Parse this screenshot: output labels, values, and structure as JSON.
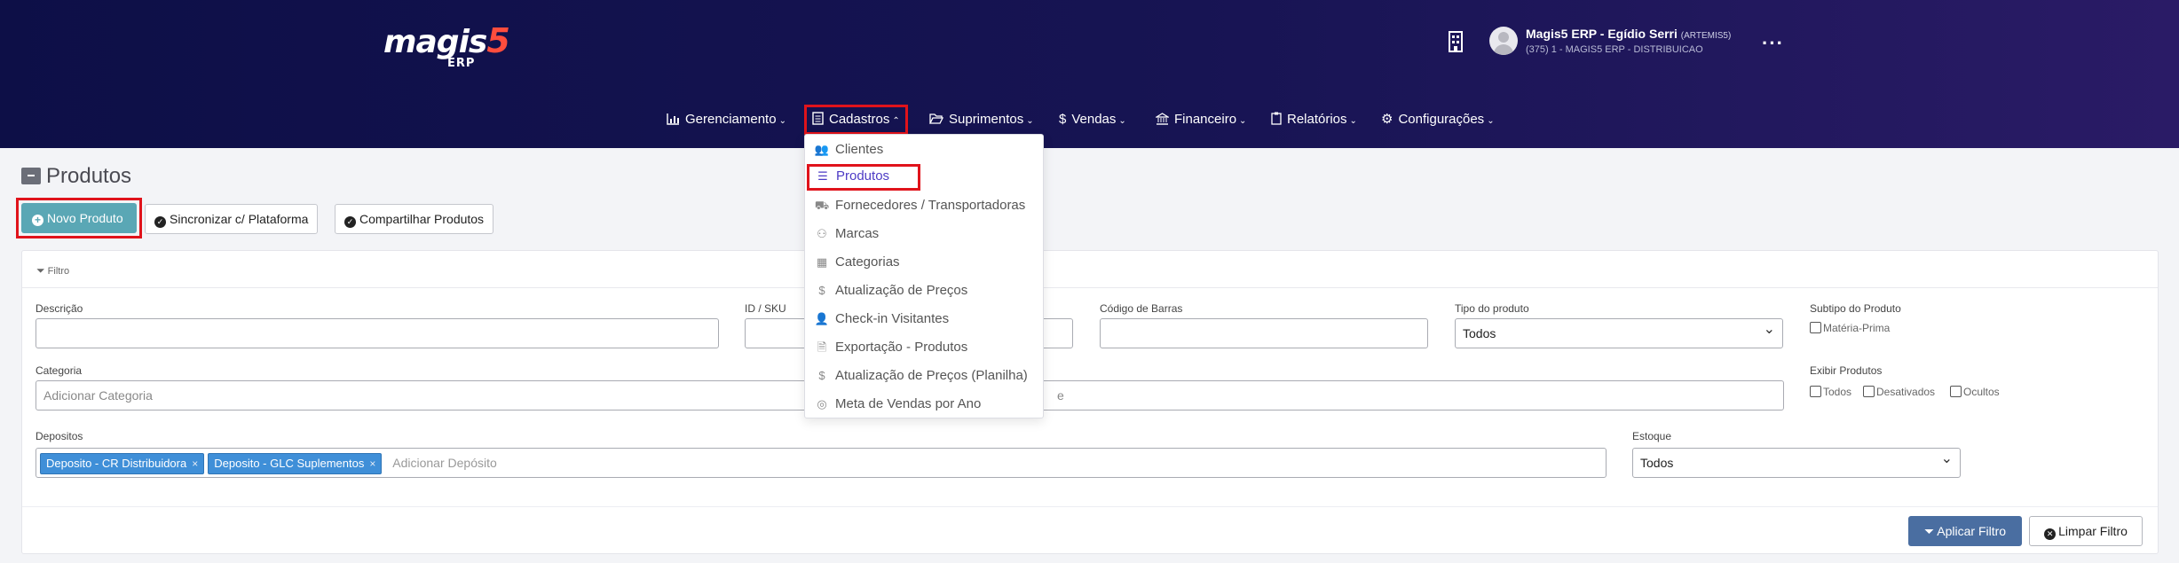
{
  "header": {
    "logo_text": "magis",
    "logo_five": "5",
    "logo_sub": "ERP",
    "user_name": "Magis5 ERP - Egídio Serri",
    "user_tag": "(ARTEMIS5)",
    "user_company": "(375) 1 - MAGIS5 ERP - DISTRIBUICAO",
    "more": "···"
  },
  "nav": {
    "items": [
      {
        "label": "Gerenciamento",
        "icon": "chart-icon"
      },
      {
        "label": "Cadastros",
        "icon": "document-icon"
      },
      {
        "label": "Suprimentos",
        "icon": "folder-open-icon"
      },
      {
        "label": "Vendas",
        "icon": "dollar-icon"
      },
      {
        "label": "Financeiro",
        "icon": "bank-icon"
      },
      {
        "label": "Relatórios",
        "icon": "clipboard-icon"
      },
      {
        "label": "Configurações",
        "icon": "gear-icon"
      }
    ]
  },
  "dropdown": {
    "items": [
      {
        "label": "Clientes",
        "icon": "users-icon"
      },
      {
        "label": "Produtos",
        "icon": "list-icon"
      },
      {
        "label": "Fornecedores / Transportadoras",
        "icon": "truck-icon"
      },
      {
        "label": "Marcas",
        "icon": "sitemap-icon"
      },
      {
        "label": "Categorias",
        "icon": "grid-icon"
      },
      {
        "label": "Atualização de Preços",
        "icon": "dollar-icon"
      },
      {
        "label": "Check-in Visitantes",
        "icon": "user-check-icon"
      },
      {
        "label": "Exportação - Produtos",
        "icon": "file-export-icon"
      },
      {
        "label": "Atualização de Preços (Planilha)",
        "icon": "dollar-icon"
      },
      {
        "label": "Meta de Vendas por Ano",
        "icon": "target-icon"
      }
    ]
  },
  "page": {
    "title": "Produtos",
    "new_button": "Novo Produto",
    "sync_button": "Sincronizar c/ Plataforma",
    "share_button": "Compartilhar Produtos"
  },
  "filter": {
    "title": "Filtro",
    "descricao_label": "Descrição",
    "sku_label": "ID / SKU",
    "barcode_label": "Código de Barras",
    "tipo_label": "Tipo do produto",
    "tipo_value": "Todos",
    "subtipo_label": "Subtipo do Produto",
    "subtipo_option": "Matéria-Prima",
    "categoria_label": "Categoria",
    "categoria_placeholder": "Adicionar Categoria",
    "marca_placeholder_tail": "e",
    "exibir_label": "Exibir Produtos",
    "exibir_todos": "Todos",
    "exibir_desativados": "Desativados",
    "exibir_ocultos": "Ocultos",
    "depositos_label": "Depositos",
    "deposito_tags": [
      "Deposito - CR Distribuidora",
      "Deposito - GLC Suplementos"
    ],
    "deposito_placeholder": "Adicionar Depósito",
    "estoque_label": "Estoque",
    "estoque_value": "Todos",
    "apply_button": "Aplicar Filtro",
    "clear_button": "Limpar Filtro"
  }
}
